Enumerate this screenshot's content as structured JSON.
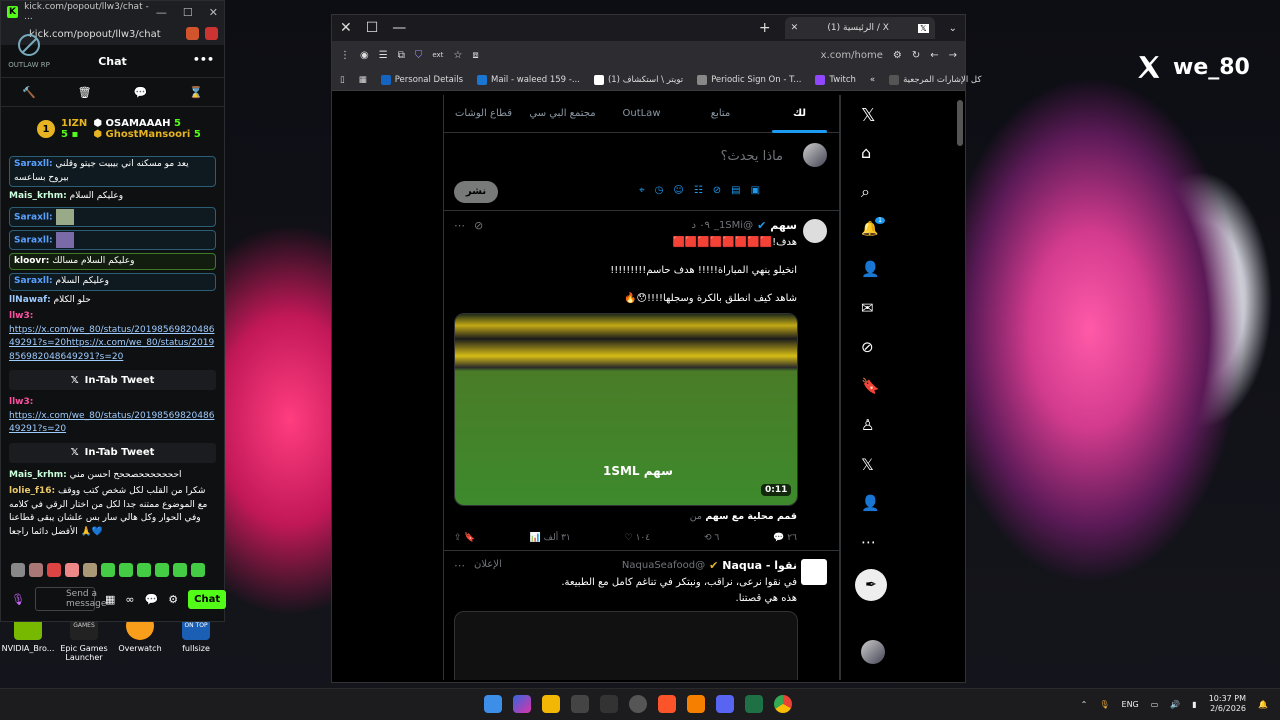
{
  "brand": {
    "handle": "we_80"
  },
  "desktop_icons": [
    {
      "label": "NVIDIA_Bro..."
    },
    {
      "label": "Epic Games Launcher"
    },
    {
      "label": "Overwatch"
    },
    {
      "label": "fullsize"
    }
  ],
  "desktop_icon_caption": "ON TOP",
  "desktop_icon_caption2": "GAMES",
  "kick": {
    "title_url": "kick.com/popout/llw3/chat - ...",
    "url": "kick.com/popout/llw3/chat",
    "header": "Chat",
    "outlaw": "OUTLAW RP",
    "leaderboard": {
      "rank": "1",
      "left": "1IZN",
      "left_count": "5",
      "top_user": "OSAMAAAH",
      "top_count": "5",
      "second_user": "GhostMansoori",
      "second_count": "5"
    },
    "messages": [
      {
        "user": "Saraxll:",
        "text": "يعد مو مسكنه اني بيبيت جيتو وقلني بيروح بساعسه"
      },
      {
        "user": "Mais_krhm:",
        "text": "وعليكم السلام"
      },
      {
        "user": "Saraxll:",
        "text": ""
      },
      {
        "user": "Saraxll:",
        "text": ""
      },
      {
        "user": "kloovr:",
        "text": "وعليكم السلام مسالك"
      },
      {
        "user": "Saraxll:",
        "text": "وعليكم السلام"
      },
      {
        "user": "llNawaf:",
        "text": "حلو الكلام"
      }
    ],
    "tweet_msgs": [
      {
        "user": "llw3:",
        "link": "https://x.com/we_80/status/2019856982048649291?s=20https://x.com/we_80/status/2019856982048649291?s=20"
      },
      {
        "user": "llw3:",
        "link": "https://x.com/we_80/status/2019856982048649291?s=20"
      }
    ],
    "intab_label": "In-Tab Tweet",
    "later_msgs": [
      {
        "user": "Mais_krhm:",
        "text": "احححححححصححح احسن مني"
      },
      {
        "user": "lolie_f16:",
        "text": "شكرا من القلب لكل شخص كتب ووقف مع الموضوع ممتنه جدا لكل من اختار الرقي في كلامه وفي الحوار وكل هالي سار بس علشان يبقى قطاعنا الأفضل دائما راجعا 🙏💙"
      }
    ],
    "send_placeholder": "Send a message",
    "chat_button": "Chat"
  },
  "edge": {
    "tab_title": "(1) الرئيسية / X",
    "url": "x.com/home",
    "bookmarks": [
      "Personal Details",
      "Mail - waleed 159 -...",
      "(1) تويتر \\ استكشاف",
      "Periodic Sign On - T...",
      "Twitch",
      "كل الإشارات المرجعية"
    ]
  },
  "x": {
    "tabs": [
      "لك",
      "متابع",
      "OutLaw",
      "مجتمع البي سي",
      "قطاع الوشات"
    ],
    "compose_placeholder": "ماذا يحدث؟",
    "post_button": "نشر",
    "tweet1": {
      "name": "سهم",
      "handle": "@1SMi_",
      "time": "٠٩ د",
      "line1": "هدف!🟥🟥🟥🟥🟥🟥🟥🟥",
      "line2": "انخيلو ينهي المباراة!!!!! هدف حاسم!!!!!!!!!",
      "line3": "شاهد كيف انطلق بالكرة وسجلها!!!!😯🔥",
      "duration": "0:11",
      "watermark": "سهم 1SML",
      "caption": "قمم محلية مع سهم",
      "caption_tail": "من",
      "stats": {
        "views": "٣١ ألف",
        "likes": "١٠٤",
        "retweets": "٦",
        "replies": "٢٦"
      }
    },
    "tweet2": {
      "name": "نقوا - Naqua",
      "handle": "@NaquaSeafood",
      "ad": "الإعلان",
      "line1": "في نقوا نرعى، نراقب، ونبتكر في تناغم كامل مع الطبيعة.",
      "line2": "هذه هي قصتنا."
    },
    "notif_count": "1"
  },
  "taskbar": {
    "lang": "ENG",
    "time": "10:37 PM",
    "date": "2/6/2026"
  }
}
